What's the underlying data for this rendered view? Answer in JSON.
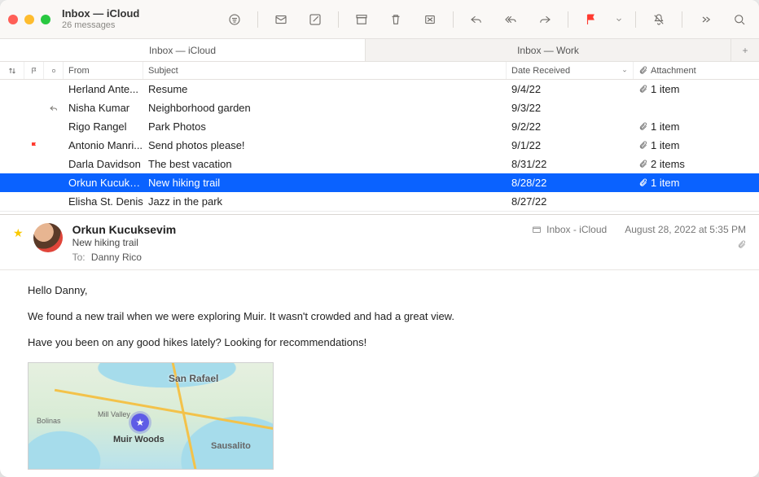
{
  "window": {
    "title": "Inbox — iCloud",
    "subtitle": "26 messages"
  },
  "tabs": [
    {
      "label": "Inbox — iCloud",
      "active": true
    },
    {
      "label": "Inbox — Work",
      "active": false
    }
  ],
  "columns": {
    "from": "From",
    "subject": "Subject",
    "date": "Date Received",
    "attachment": "Attachment"
  },
  "messages": [
    {
      "from": "Herland Ante...",
      "subject": "Resume",
      "date": "9/4/22",
      "attach": "1 item",
      "flag": false,
      "replied": false
    },
    {
      "from": "Nisha Kumar",
      "subject": "Neighborhood garden",
      "date": "9/3/22",
      "attach": "",
      "flag": false,
      "replied": true
    },
    {
      "from": "Rigo Rangel",
      "subject": "Park Photos",
      "date": "9/2/22",
      "attach": "1 item",
      "flag": false,
      "replied": false
    },
    {
      "from": "Antonio Manri...",
      "subject": "Send photos please!",
      "date": "9/1/22",
      "attach": "1 item",
      "flag": true,
      "replied": false
    },
    {
      "from": "Darla Davidson",
      "subject": "The best vacation",
      "date": "8/31/22",
      "attach": "2 items",
      "flag": false,
      "replied": false
    },
    {
      "from": "Orkun Kucuks...",
      "subject": "New hiking trail",
      "date": "8/28/22",
      "attach": "1 item",
      "flag": false,
      "replied": false,
      "selected": true
    },
    {
      "from": "Elisha St. Denis",
      "subject": "Jazz in the park",
      "date": "8/27/22",
      "attach": "",
      "flag": false,
      "replied": false
    }
  ],
  "preview": {
    "sender": "Orkun Kucuksevim",
    "subject": "New hiking trail",
    "to_label": "To:",
    "to_value": "Danny Rico",
    "folder": "Inbox - iCloud",
    "date": "August 28, 2022 at 5:35 PM",
    "body": [
      "Hello Danny,",
      "We found a new trail when we were exploring Muir. It wasn't crowded and had a great view.",
      "Have you been on any good hikes lately? Looking for recommendations!"
    ],
    "map": {
      "pin_label": "Muir Woods",
      "city1": "San Rafael",
      "city2": "Sausalito",
      "city3": "Mill Valley",
      "city4": "Bolinas"
    }
  }
}
